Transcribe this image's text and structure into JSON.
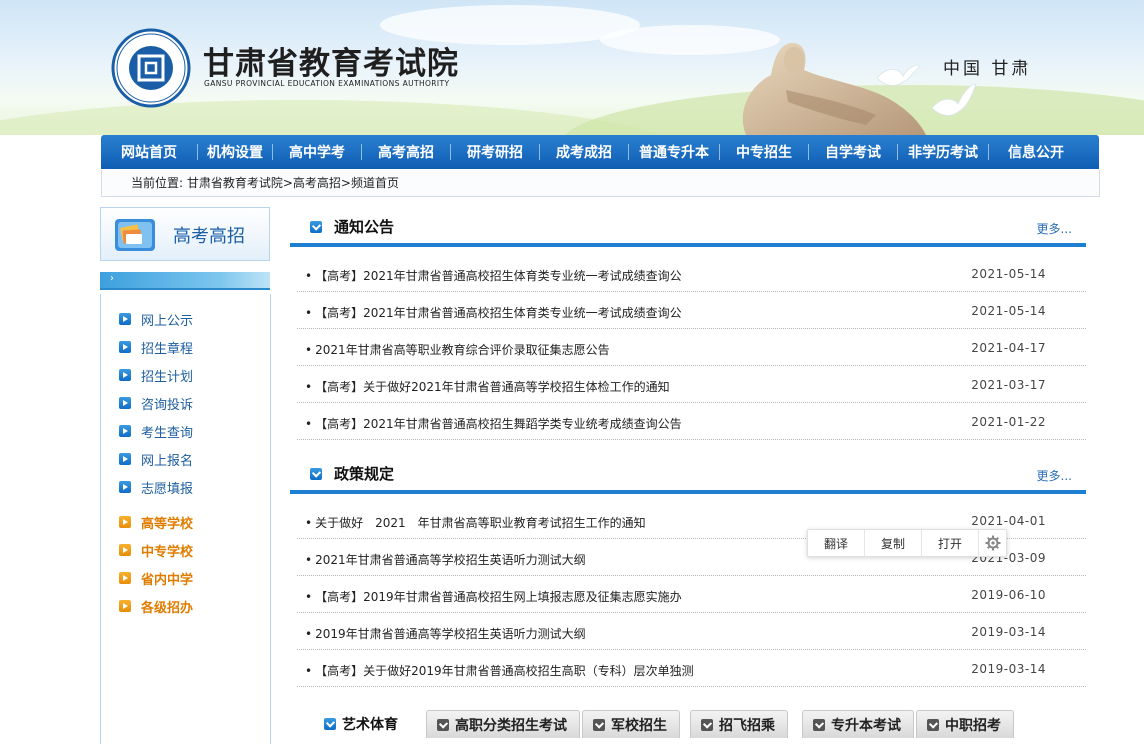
{
  "header": {
    "site_name_cn": "甘肃省教育考试院",
    "site_name_en": "GANSU PROVINCIAL EDUCATION EXAMINATIONS AUTHORITY",
    "region": "中国 甘肃",
    "emblem_char": "回",
    "emblem_ring_text": "甘肃省教育考试院"
  },
  "nav": {
    "items": [
      "网站首页",
      "机构设置",
      "高中学考",
      "高考高招",
      "研考研招",
      "成考成招",
      "普通专升本",
      "中专招生",
      "自学考试",
      "非学历考试",
      "信息公开"
    ]
  },
  "breadcrumb": {
    "text": "当前位置: 甘肃省教育考试院>高考高招>频道首页"
  },
  "sidebar": {
    "title": "高考高招",
    "bar_arrow": "›",
    "links": [
      "网上公示",
      "招生章程",
      "招生计划",
      "咨询投诉",
      "考生查询",
      "网上报名",
      "志愿填报"
    ],
    "highlights": [
      "高等学校",
      "中专学校",
      "省内中学",
      "各级招办"
    ]
  },
  "notices": {
    "title": "通知公告",
    "more": "更多...",
    "items": [
      {
        "title": "【高考】2021年甘肃省普通高校招生体育类专业统一考试成绩查询公",
        "date": "2021-05-14"
      },
      {
        "title": "【高考】2021年甘肃省普通高校招生体育类专业统一考试成绩查询公",
        "date": "2021-05-14"
      },
      {
        "title": "2021年甘肃省高等职业教育综合评价录取征集志愿公告",
        "date": "2021-04-17"
      },
      {
        "title": "【高考】关于做好2021年甘肃省普通高等学校招生体检工作的通知",
        "date": "2021-03-17"
      },
      {
        "title": "【高考】2021年甘肃省普通高校招生舞蹈学类专业统考成绩查询公告",
        "date": "2021-01-22"
      }
    ]
  },
  "policies": {
    "title": "政策规定",
    "more": "更多...",
    "items": [
      {
        "title": "关于做好　2021　年甘肃省高等职业教育考试招生工作的通知",
        "date": "2021-04-01"
      },
      {
        "title": "2021年甘肃省普通高等学校招生英语听力测试大纲",
        "date": "2021-03-09"
      },
      {
        "title": "【高考】2019年甘肃省普通高校招生网上填报志愿及征集志愿实施办",
        "date": "2019-06-10"
      },
      {
        "title": "2019年甘肃省普通高等学校招生英语听力测试大纲",
        "date": "2019-03-14"
      },
      {
        "title": "【高考】关于做好2019年甘肃省普通高校招生高职（专科）层次单独测",
        "date": "2019-03-14"
      }
    ]
  },
  "float_bar": {
    "translate": "翻译",
    "copy": "复制",
    "open": "打开"
  },
  "bottom_tabs": {
    "active": "艺术体育",
    "others": [
      "高职分类招生考试",
      "军校招生",
      "招飞招乘",
      "专升本考试",
      "中职招考"
    ]
  },
  "colors": {
    "nav": "#1767bd",
    "accent": "#1e7fd2",
    "link": "#1d5ea0",
    "orange": "#e07d00"
  }
}
